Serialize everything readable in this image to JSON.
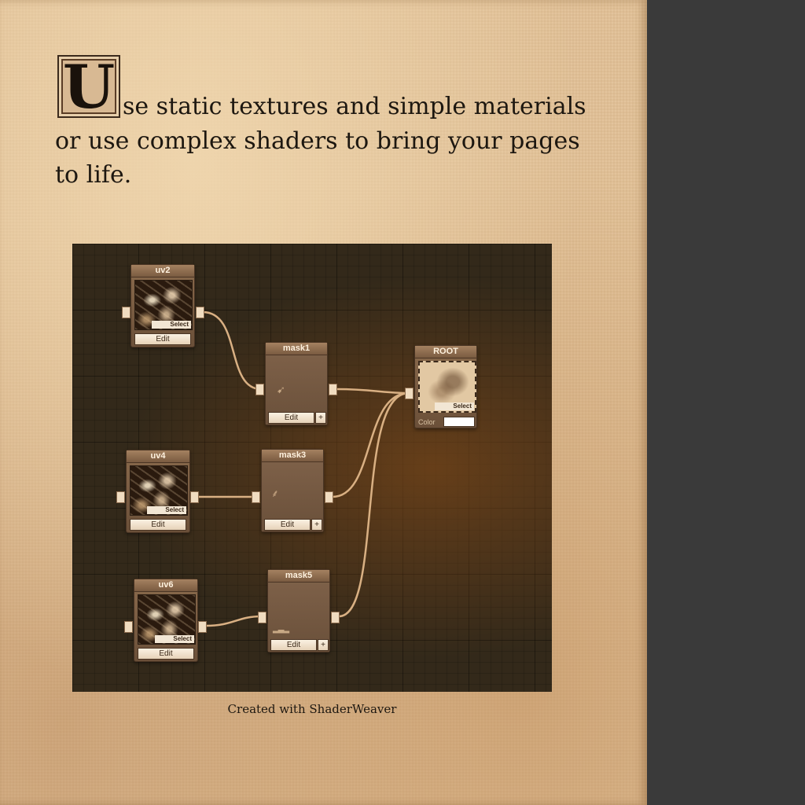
{
  "intro": {
    "dropcap": "U",
    "line1": "se static textures and simple materials",
    "line2": "or use complex shaders to bring your pages",
    "line3": "to life."
  },
  "graph": {
    "nodes": {
      "uv2": {
        "title": "uv2",
        "select": "Select",
        "edit": "Edit"
      },
      "uv4": {
        "title": "uv4",
        "select": "Select",
        "edit": "Edit"
      },
      "uv6": {
        "title": "uv6",
        "select": "Select",
        "edit": "Edit"
      },
      "mask1": {
        "title": "mask1",
        "edit": "Edit",
        "plus": "+"
      },
      "mask3": {
        "title": "mask3",
        "edit": "Edit",
        "plus": "+"
      },
      "mask5": {
        "title": "mask5",
        "edit": "Edit",
        "plus": "+"
      },
      "root": {
        "title": "ROOT",
        "select": "Select",
        "color_label": "Color",
        "color_value": "#ffffff"
      }
    }
  },
  "caption": "Created with ShaderWeaver",
  "colors": {
    "paper": "#e2c298",
    "graph_bg": "#33291a",
    "node": "#7a5b41",
    "wire": "#d9b083",
    "side_panel": "#3a3a3a"
  }
}
